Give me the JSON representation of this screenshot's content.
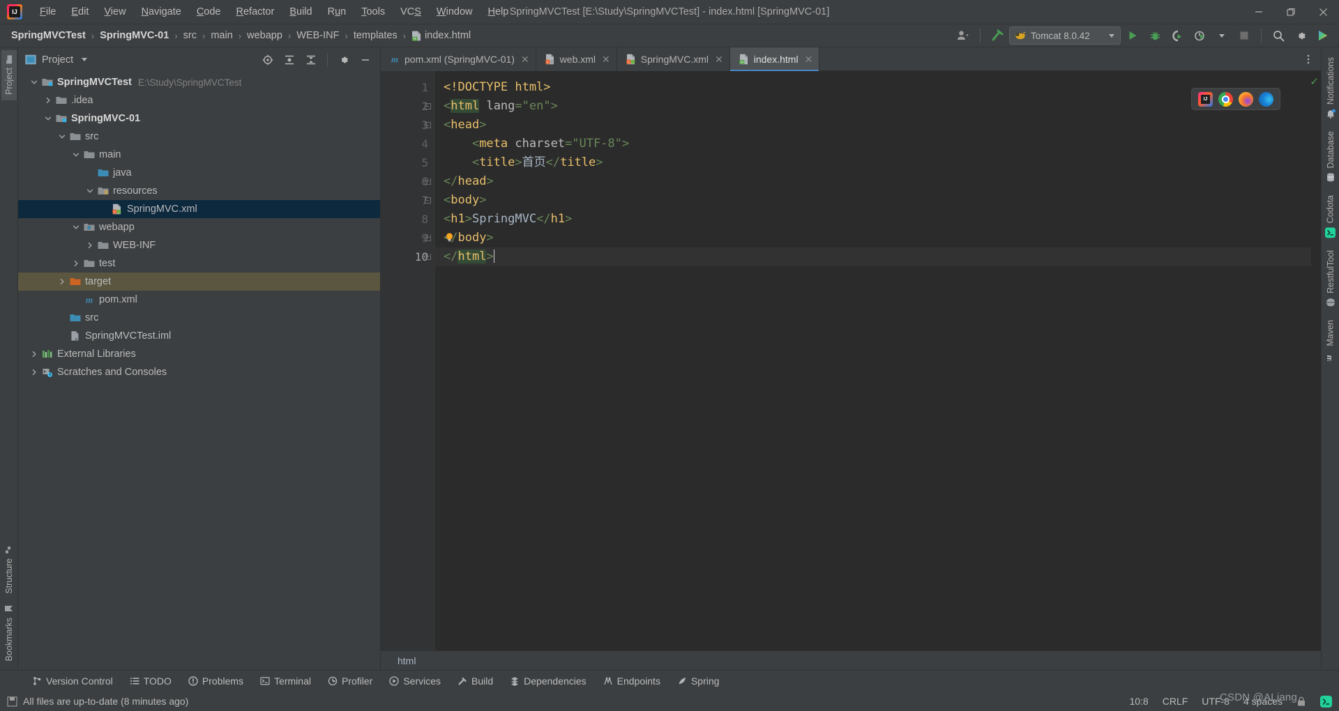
{
  "window": {
    "title": "SpringMVCTest [E:\\Study\\SpringMVCTest] - index.html [SpringMVC-01]",
    "minimize_label": "—",
    "maximize_label": "❐",
    "close_label": "✕"
  },
  "menubar": {
    "items": [
      {
        "label": "File",
        "mnemonic": "F"
      },
      {
        "label": "Edit",
        "mnemonic": "E"
      },
      {
        "label": "View",
        "mnemonic": "V"
      },
      {
        "label": "Navigate",
        "mnemonic": "N"
      },
      {
        "label": "Code",
        "mnemonic": "C"
      },
      {
        "label": "Refactor",
        "mnemonic": "R"
      },
      {
        "label": "Build",
        "mnemonic": "B"
      },
      {
        "label": "Run",
        "mnemonic": "u"
      },
      {
        "label": "Tools",
        "mnemonic": "T"
      },
      {
        "label": "VCS",
        "mnemonic": "S"
      },
      {
        "label": "Window",
        "mnemonic": "W"
      },
      {
        "label": "Help",
        "mnemonic": "H"
      }
    ]
  },
  "breadcrumb": {
    "items": [
      "SpringMVCTest",
      "SpringMVC-01",
      "src",
      "main",
      "webapp",
      "WEB-INF",
      "templates",
      "index.html"
    ],
    "separator": "›"
  },
  "toolbar": {
    "account_icon": "user-account-icon",
    "hammer_icon": "build-hammer-icon",
    "run_config": {
      "label": "Tomcat 8.0.42",
      "icon": "tomcat-icon"
    },
    "run_icon": "run-play-icon",
    "debug_icon": "debug-bug-icon",
    "run_coverage_icon": "run-with-coverage-icon",
    "profiler_icon": "profiler-icon",
    "stop_icon": "stop-square-icon",
    "search_icon": "search-icon",
    "settings_icon": "gear-icon",
    "updates_icon": "ide-updates-icon",
    "accent_green": "#499C54",
    "accent_blue": "#4A88C7"
  },
  "left_stripe": {
    "top": [
      {
        "label": "Project",
        "icon": "project-folder-icon",
        "active": true
      }
    ],
    "bottom": [
      {
        "label": "Structure",
        "icon": "structure-icon"
      },
      {
        "label": "Bookmarks",
        "icon": "bookmark-icon"
      }
    ]
  },
  "right_stripe": {
    "items": [
      {
        "label": "Notifications",
        "icon": "bell-icon"
      },
      {
        "label": "Database",
        "icon": "database-icon"
      },
      {
        "label": "Codota",
        "icon": "codota-icon"
      },
      {
        "label": "RestfulTool",
        "icon": "globe-icon"
      },
      {
        "label": "Maven",
        "icon": "maven-m-icon"
      }
    ]
  },
  "project_panel": {
    "title": "Project",
    "dropdown_icon": "chevron-down-icon",
    "tools": [
      "locate-target-icon",
      "expand-all-icon",
      "collapse-all-icon",
      "gear-icon",
      "minimize-icon"
    ],
    "tree": [
      {
        "label": "SpringMVCTest",
        "sub": "E:\\Study\\SpringMVCTest",
        "indent": 0,
        "arrow": "expanded",
        "icon": "module-folder-icon",
        "bold": true
      },
      {
        "label": ".idea",
        "indent": 1,
        "arrow": "collapsed",
        "icon": "folder-icon"
      },
      {
        "label": "SpringMVC-01",
        "indent": 1,
        "arrow": "expanded",
        "icon": "module-folder-icon",
        "bold": true
      },
      {
        "label": "src",
        "indent": 2,
        "arrow": "expanded",
        "icon": "folder-icon"
      },
      {
        "label": "main",
        "indent": 3,
        "arrow": "expanded",
        "icon": "folder-icon"
      },
      {
        "label": "java",
        "indent": 4,
        "arrow": "none",
        "icon": "source-folder-icon"
      },
      {
        "label": "resources",
        "indent": 4,
        "arrow": "expanded",
        "icon": "resources-folder-icon"
      },
      {
        "label": "SpringMVC.xml",
        "indent": 5,
        "arrow": "none",
        "icon": "spring-xml-icon",
        "state": "selected"
      },
      {
        "label": "webapp",
        "indent": 3,
        "arrow": "expanded",
        "icon": "webapp-folder-icon"
      },
      {
        "label": "WEB-INF",
        "indent": 4,
        "arrow": "collapsed",
        "icon": "folder-icon"
      },
      {
        "label": "test",
        "indent": 3,
        "arrow": "collapsed",
        "icon": "folder-icon"
      },
      {
        "label": "target",
        "indent": 2,
        "arrow": "collapsed",
        "icon": "excluded-folder-icon",
        "state": "highlighted"
      },
      {
        "label": "pom.xml",
        "indent": 3,
        "arrow": "none",
        "icon": "maven-m-icon"
      },
      {
        "label": "src",
        "indent": 2,
        "arrow": "none",
        "icon": "source-folder-icon"
      },
      {
        "label": "SpringMVCTest.iml",
        "indent": 2,
        "arrow": "none",
        "icon": "iml-icon"
      },
      {
        "label": "External Libraries",
        "indent": 0,
        "arrow": "collapsed",
        "icon": "libraries-icon"
      },
      {
        "label": "Scratches and Consoles",
        "indent": 0,
        "arrow": "collapsed",
        "icon": "scratches-icon"
      }
    ]
  },
  "editor": {
    "tabs": [
      {
        "label": "pom.xml (SpringMVC-01)",
        "icon": "maven-m-icon",
        "active": false,
        "close": "✕"
      },
      {
        "label": "web.xml",
        "icon": "web-xml-icon",
        "active": false,
        "close": "✕"
      },
      {
        "label": "SpringMVC.xml",
        "icon": "spring-xml-icon",
        "active": false,
        "close": "✕"
      },
      {
        "label": "index.html",
        "icon": "html-file-icon",
        "active": true,
        "close": "✕"
      }
    ],
    "line_numbers": [
      "1",
      "2",
      "3",
      "4",
      "5",
      "6",
      "7",
      "8",
      "9",
      "10"
    ],
    "current_line": 10,
    "code_lines": [
      {
        "n": 1,
        "fold": false,
        "tokens": [
          {
            "t": "<!DOCTYPE html>",
            "c": "tok-doctype"
          }
        ]
      },
      {
        "n": 2,
        "fold": "open",
        "tokens": [
          {
            "t": "<",
            "c": "tok-brk"
          },
          {
            "t": "html",
            "c": "tok-tag highlighted"
          },
          {
            "t": " ",
            "c": "tok-txt"
          },
          {
            "t": "lang",
            "c": "tok-attr"
          },
          {
            "t": "=",
            "c": "tok-brk"
          },
          {
            "t": "\"en\"",
            "c": "tok-str"
          },
          {
            "t": ">",
            "c": "tok-brk"
          }
        ]
      },
      {
        "n": 3,
        "fold": "open",
        "tokens": [
          {
            "t": "<",
            "c": "tok-brk"
          },
          {
            "t": "head",
            "c": "tok-tag"
          },
          {
            "t": ">",
            "c": "tok-brk"
          }
        ]
      },
      {
        "n": 4,
        "fold": false,
        "tokens": [
          {
            "t": "    <",
            "c": "tok-brk"
          },
          {
            "t": "meta",
            "c": "tok-tag"
          },
          {
            "t": " ",
            "c": "tok-txt"
          },
          {
            "t": "charset",
            "c": "tok-attr"
          },
          {
            "t": "=",
            "c": "tok-brk"
          },
          {
            "t": "\"UTF-8\"",
            "c": "tok-str"
          },
          {
            "t": ">",
            "c": "tok-brk"
          }
        ]
      },
      {
        "n": 5,
        "fold": false,
        "tokens": [
          {
            "t": "    <",
            "c": "tok-brk"
          },
          {
            "t": "title",
            "c": "tok-tag"
          },
          {
            "t": ">",
            "c": "tok-brk"
          },
          {
            "t": "首页",
            "c": "tok-txt"
          },
          {
            "t": "</",
            "c": "tok-brk"
          },
          {
            "t": "title",
            "c": "tok-tag"
          },
          {
            "t": ">",
            "c": "tok-brk"
          }
        ]
      },
      {
        "n": 6,
        "fold": "close",
        "tokens": [
          {
            "t": "</",
            "c": "tok-brk"
          },
          {
            "t": "head",
            "c": "tok-tag"
          },
          {
            "t": ">",
            "c": "tok-brk"
          }
        ]
      },
      {
        "n": 7,
        "fold": "open",
        "tokens": [
          {
            "t": "<",
            "c": "tok-brk"
          },
          {
            "t": "body",
            "c": "tok-tag"
          },
          {
            "t": ">",
            "c": "tok-brk"
          }
        ]
      },
      {
        "n": 8,
        "fold": false,
        "tokens": [
          {
            "t": "<",
            "c": "tok-brk"
          },
          {
            "t": "h1",
            "c": "tok-tag"
          },
          {
            "t": ">",
            "c": "tok-brk"
          },
          {
            "t": "SpringMVC",
            "c": "tok-txt"
          },
          {
            "t": "</",
            "c": "tok-brk"
          },
          {
            "t": "h1",
            "c": "tok-tag"
          },
          {
            "t": ">",
            "c": "tok-brk"
          }
        ]
      },
      {
        "n": 9,
        "fold": "close",
        "tokens": [
          {
            "t": "</",
            "c": "tok-brk"
          },
          {
            "t": "body",
            "c": "tok-tag"
          },
          {
            "t": ">",
            "c": "tok-brk"
          }
        ]
      },
      {
        "n": 10,
        "fold": "close",
        "tokens": [
          {
            "t": "</",
            "c": "tok-brk"
          },
          {
            "t": "html",
            "c": "tok-tag highlighted"
          },
          {
            "t": ">",
            "c": "tok-brk"
          }
        ]
      }
    ],
    "intention_bulb": "lightbulb-icon",
    "inspection_status": "✓",
    "browsers": [
      {
        "name": "intellij-browser-icon"
      },
      {
        "name": "chrome-browser-icon"
      },
      {
        "name": "firefox-browser-icon"
      },
      {
        "name": "edge-browser-icon"
      }
    ],
    "breadcrumb_bottom": "html"
  },
  "bottom_tools": [
    {
      "label": "Version Control",
      "icon": "vcs-branch-icon"
    },
    {
      "label": "TODO",
      "icon": "todo-list-icon"
    },
    {
      "label": "Problems",
      "icon": "problems-icon"
    },
    {
      "label": "Terminal",
      "icon": "terminal-icon"
    },
    {
      "label": "Profiler",
      "icon": "profiler-icon"
    },
    {
      "label": "Services",
      "icon": "services-icon"
    },
    {
      "label": "Build",
      "icon": "build-hammer-icon"
    },
    {
      "label": "Dependencies",
      "icon": "dependencies-icon"
    },
    {
      "label": "Endpoints",
      "icon": "endpoints-icon"
    },
    {
      "label": "Spring",
      "icon": "spring-leaf-icon"
    }
  ],
  "status_bar": {
    "message": "All files are up-to-date (8 minutes ago)",
    "message_icon": "save-all-icon",
    "caret_position": "10:8",
    "line_separator": "CRLF",
    "encoding": "UTF-8",
    "indent": "4 spaces",
    "lock_icon": "read-only-lock-icon",
    "codota_icon": "codota-icon",
    "watermark": "CSDN @ALiang"
  }
}
